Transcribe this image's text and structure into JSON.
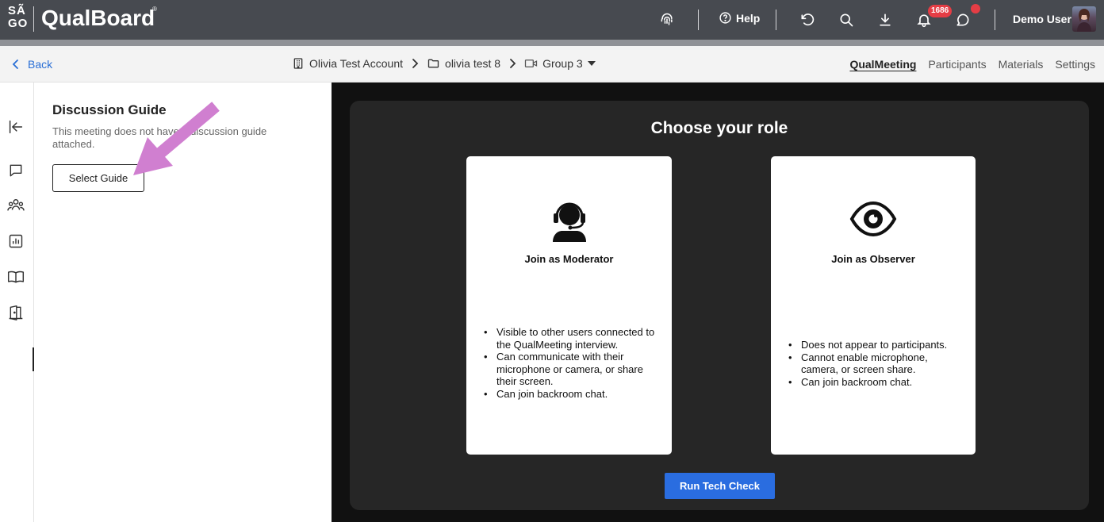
{
  "brand": {
    "mark": "SÃ GO",
    "mark_line1": "SÃ",
    "mark_line2": "GO",
    "name": "QualBoard",
    "reg": "®"
  },
  "topbar": {
    "help_label": "Help",
    "notification_count": "1686",
    "user_name": "Demo User",
    "icons": [
      "fingerprint-icon",
      "help-icon",
      "undo-icon",
      "search-icon",
      "download-icon",
      "bell-icon",
      "chat-icon"
    ]
  },
  "subheader": {
    "back_label": "Back",
    "breadcrumbs": [
      {
        "label": "Olivia Test Account",
        "icon": "building-icon"
      },
      {
        "label": "olivia test 8",
        "icon": "folder-icon"
      },
      {
        "label": "Group 3",
        "icon": "video-icon"
      }
    ],
    "tabs": [
      {
        "label": "QualMeeting",
        "active": true
      },
      {
        "label": "Participants",
        "active": false
      },
      {
        "label": "Materials",
        "active": false
      },
      {
        "label": "Settings",
        "active": false
      }
    ]
  },
  "rail": {
    "icons": [
      "collapse-icon",
      "chat-icon",
      "people-icon",
      "chart-icon",
      "book-icon",
      "door-icon"
    ]
  },
  "guide": {
    "title": "Discussion Guide",
    "description": "This meeting does not have a discussion guide attached.",
    "select_label": "Select Guide"
  },
  "role": {
    "title": "Choose your role",
    "moderator": {
      "title": "Join as Moderator",
      "bullets": [
        "Visible to other users connected to the QualMeeting interview.",
        "Can communicate with their microphone or camera, or share their screen.",
        "Can join backroom chat."
      ]
    },
    "observer": {
      "title": "Join as Observer",
      "bullets": [
        "Does not appear to participants.",
        "Cannot enable microphone, camera, or screen share.",
        "Can join backroom chat."
      ]
    },
    "tech_check_label": "Run Tech Check"
  },
  "colors": {
    "topbar": "#474a50",
    "accent": "#2a6de0",
    "link": "#2a6fd6",
    "badge": "#e53d45",
    "annotation_arrow": "#d07fd0"
  }
}
